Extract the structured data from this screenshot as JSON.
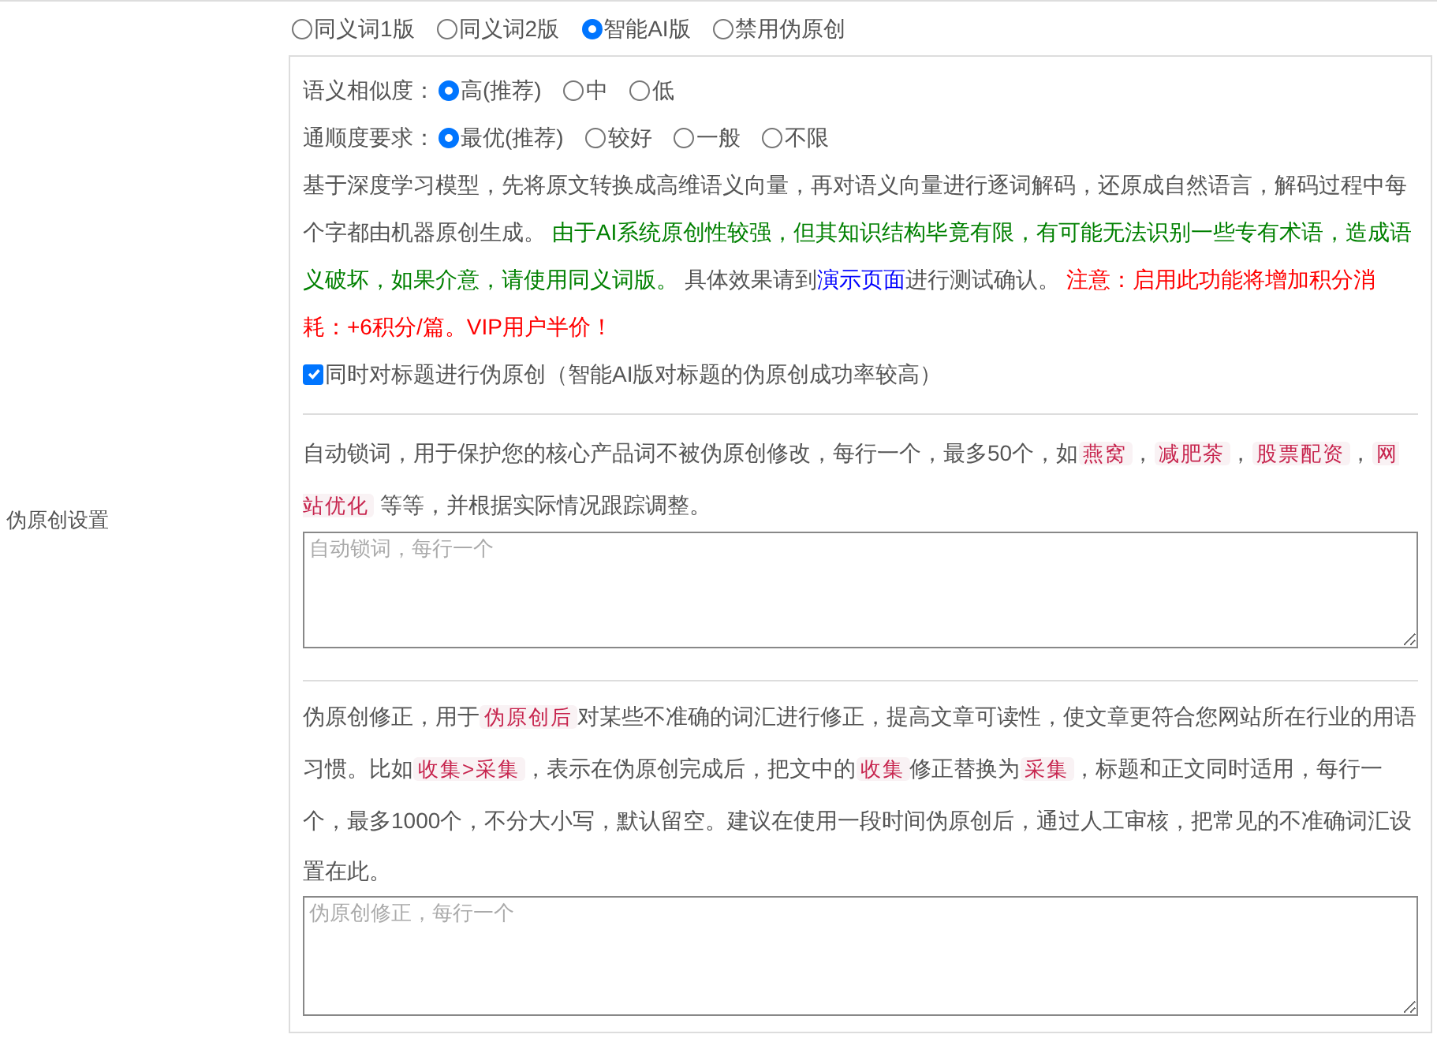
{
  "section_label": "伪原创设置",
  "modes": [
    {
      "label": "同义词1版",
      "selected": false
    },
    {
      "label": "同义词2版",
      "selected": false
    },
    {
      "label": "智能AI版",
      "selected": true
    },
    {
      "label": "禁用伪原创",
      "selected": false
    }
  ],
  "similarity": {
    "label": "语义相似度：",
    "options": [
      {
        "label": "高(推荐)",
        "selected": true
      },
      {
        "label": "中",
        "selected": false
      },
      {
        "label": "低",
        "selected": false
      }
    ]
  },
  "fluency": {
    "label": "通顺度要求：",
    "options": [
      {
        "label": "最优(推荐)",
        "selected": true
      },
      {
        "label": "较好",
        "selected": false
      },
      {
        "label": "一般",
        "selected": false
      },
      {
        "label": "不限",
        "selected": false
      }
    ]
  },
  "ai_description": [
    {
      "kind": "text",
      "text": "基于深度学习模型，先将原文转换成高维语义向量，再对语义向量进行逐词解码，还原成自然语言，解码过程中每个字都由机器原创生成。 "
    },
    {
      "kind": "green",
      "text": "由于AI系统原创性较强，但其知识结构毕竟有限，有可能无法识别一些专有术语，造成语义破坏，如果介意，请使用同义词版。"
    },
    {
      "kind": "text",
      "text": " 具体效果请到"
    },
    {
      "kind": "link",
      "text": "演示页面"
    },
    {
      "kind": "text",
      "text": "进行测试确认。 "
    },
    {
      "kind": "red",
      "text": "注意：启用此功能将增加积分消耗：+6积分/篇。VIP用户半价！"
    }
  ],
  "title_option": {
    "label": "同时对标题进行伪原创（智能AI版对标题的伪原创成功率较高）",
    "checked": true
  },
  "lock_words": {
    "description": [
      {
        "kind": "text",
        "text": "自动锁词，用于保护您的核心产品词不被伪原创修改，每行一个，最多50个，如"
      },
      {
        "kind": "tag",
        "text": "燕窝"
      },
      {
        "kind": "text",
        "text": "，"
      },
      {
        "kind": "tag",
        "text": "减肥茶"
      },
      {
        "kind": "text",
        "text": "，"
      },
      {
        "kind": "tag",
        "text": "股票配资"
      },
      {
        "kind": "text",
        "text": "，"
      },
      {
        "kind": "tag",
        "text": "网站优化"
      },
      {
        "kind": "text",
        "text": " 等等，并根据实际情况跟踪调整。"
      }
    ],
    "placeholder": "自动锁词，每行一个"
  },
  "corrections": {
    "description": [
      {
        "kind": "text",
        "text": "伪原创修正，用于"
      },
      {
        "kind": "tag",
        "text": "伪原创后"
      },
      {
        "kind": "text",
        "text": "对某些不准确的词汇进行修正，提高文章可读性，使文章更符合您网站所在行业的用语习惯。比如"
      },
      {
        "kind": "tag",
        "text": "收集>采集"
      },
      {
        "kind": "text",
        "text": "，表示在伪原创完成后，把文中的"
      },
      {
        "kind": "tag",
        "text": "收集"
      },
      {
        "kind": "text",
        "text": "修正替换为"
      },
      {
        "kind": "tag",
        "text": "采集"
      },
      {
        "kind": "text",
        "text": "，标题和正文同时适用，每行一个，最多1000个，不分大小写，默认留空。建议在使用一段时间伪原创后，通过人工审核，把常见的不准确词汇设置在此。"
      }
    ],
    "placeholder": "伪原创修正，每行一个"
  }
}
